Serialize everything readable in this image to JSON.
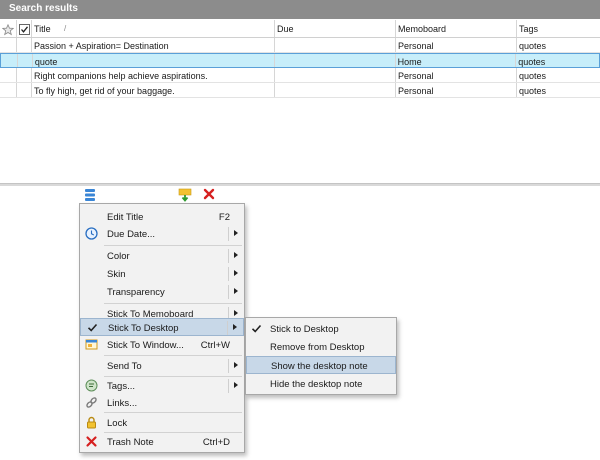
{
  "header": {
    "title": "Search results"
  },
  "table": {
    "columns": [
      "Title",
      "Due",
      "Memoboard",
      "Tags"
    ],
    "rows": [
      {
        "title": "Passion + Aspiration= Destination",
        "due": "",
        "memoboard": "Personal",
        "tags": "quotes"
      },
      {
        "title": "quote",
        "due": "",
        "memoboard": "Home",
        "tags": "quotes"
      },
      {
        "title": "Right companions help achieve aspirations.",
        "due": "",
        "memoboard": "Personal",
        "tags": "quotes"
      },
      {
        "title": "To fly high, get rid of your baggage.",
        "due": "",
        "memoboard": "Personal",
        "tags": "quotes"
      }
    ],
    "selected_row": 1
  },
  "menu": {
    "items": [
      {
        "label": "Edit Title",
        "shortcut": "F2"
      },
      {
        "label": "Due Date...",
        "icon": "clock-icon"
      },
      {
        "label": "Color"
      },
      {
        "label": "Skin"
      },
      {
        "label": "Transparency"
      },
      {
        "label": "Stick To Memoboard"
      },
      {
        "label": "Stick To Desktop",
        "icon": "checkmark-icon"
      },
      {
        "label": "Stick To Window...",
        "shortcut": "Ctrl+W",
        "icon": "window-icon"
      },
      {
        "label": "Send To"
      },
      {
        "label": "Tags...",
        "icon": "tags-icon"
      },
      {
        "label": "Links...",
        "icon": "link-icon"
      },
      {
        "label": "Lock",
        "icon": "lock-icon"
      },
      {
        "label": "Trash Note",
        "shortcut": "Ctrl+D",
        "icon": "trash-x-icon"
      }
    ]
  },
  "submenu": {
    "items": [
      {
        "label": "Stick to Desktop",
        "icon": "checkmark-icon"
      },
      {
        "label": "Remove from Desktop"
      },
      {
        "label": "Show the desktop note"
      },
      {
        "label": "Hide the desktop note"
      }
    ]
  },
  "colors": {
    "header_bg": "#8c8c8c",
    "selected_row": "#c7eefa",
    "menu_highlight": "#c8d8e8",
    "trash_red": "#d62020"
  }
}
